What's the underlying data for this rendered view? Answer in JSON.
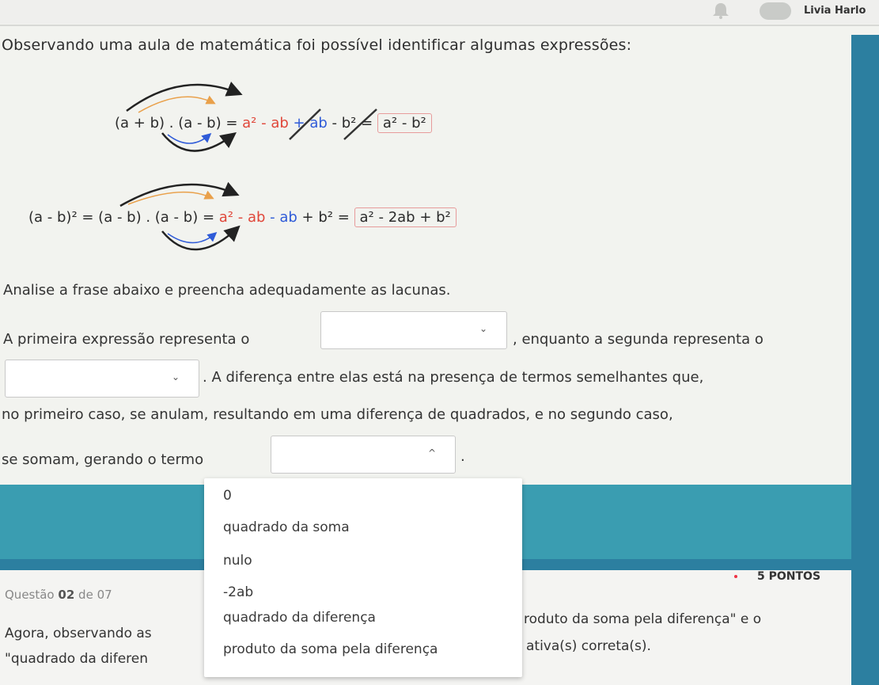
{
  "header": {
    "user_name": "Livia Harlo"
  },
  "intro": "Observando uma aula de matemática foi possível identificar algumas expressões:",
  "expressions": {
    "first": {
      "lhs": "(a + b) . (a - b) = ",
      "t1": "a²",
      "t2": " - ab",
      "t3": " + ab",
      "t4": " - b² = ",
      "result": "a² - b²"
    },
    "second": {
      "lhs": "(a - b)² = (a - b) . (a - b) = ",
      "t1": "a²",
      "t2": " - ab",
      "t3": " - ab",
      "t4": " + b² = ",
      "result": "a² - 2ab + b²"
    }
  },
  "question": {
    "instruction": "Analise a frase abaixo e preencha adequadamente as lacunas.",
    "line1_before": "A primeira expressão representa o",
    "line1_after": ", enquanto a segunda representa o",
    "line2_after": ". A diferença entre elas está na presença de termos semelhantes que,",
    "line3": "no primeiro caso, se anulam, resultando em uma diferença de quadrados, e no segundo caso,",
    "line4_before": "se somam, gerando o termo",
    "line4_after": "."
  },
  "selects": {
    "select1": {
      "value": "",
      "chevron": "⌄"
    },
    "select2": {
      "value": "",
      "chevron": "⌄"
    },
    "select3": {
      "value": "",
      "chevron": "^"
    }
  },
  "dropdown_options": [
    "0",
    "quadrado da soma",
    "nulo",
    "-2ab",
    "quadrado da diferença",
    "produto da soma pela diferença"
  ],
  "next_question": {
    "label": "Questão",
    "number": "02",
    "of": "de 07",
    "points": "5 PONTOS",
    "text1_left": "Agora, observando as",
    "text1_right": "roduto da soma pela diferença\" e o",
    "text2_left": "\"quadrado da diferen",
    "text2_right": "ativa(s) correta(s)."
  }
}
